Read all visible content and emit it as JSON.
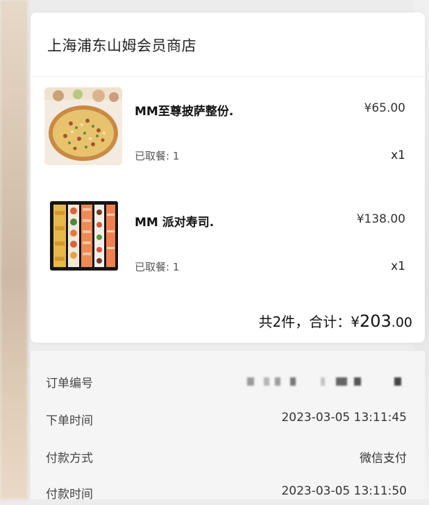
{
  "store": {
    "name": "上海浦东山姆会员商店"
  },
  "items": [
    {
      "name": "MM至尊披萨整份.",
      "price": "¥65.00",
      "taken": "已取餐: 1",
      "qty": "x1",
      "icon": "pizza-image"
    },
    {
      "name": "MM 派对寿司.",
      "price": "¥138.00",
      "taken": "已取餐: 1",
      "qty": "x1",
      "icon": "sushi-platter-image"
    }
  ],
  "summary": {
    "prefix": "共2件，合计：¥",
    "amount_main": "203",
    "amount_decimal": ".00"
  },
  "details": {
    "order_no_label": "订单编号",
    "order_time_label": "下单时间",
    "order_time_value": "2023-03-05 13:11:45",
    "pay_method_label": "付款方式",
    "pay_method_value": "微信支付",
    "pay_time_label": "付款时间",
    "pay_time_value": "2023-03-05 13:11:50"
  },
  "colors": {
    "card_bg": "#ffffff",
    "page_bg": "#ececec",
    "details_bg": "#f5f5f5"
  }
}
